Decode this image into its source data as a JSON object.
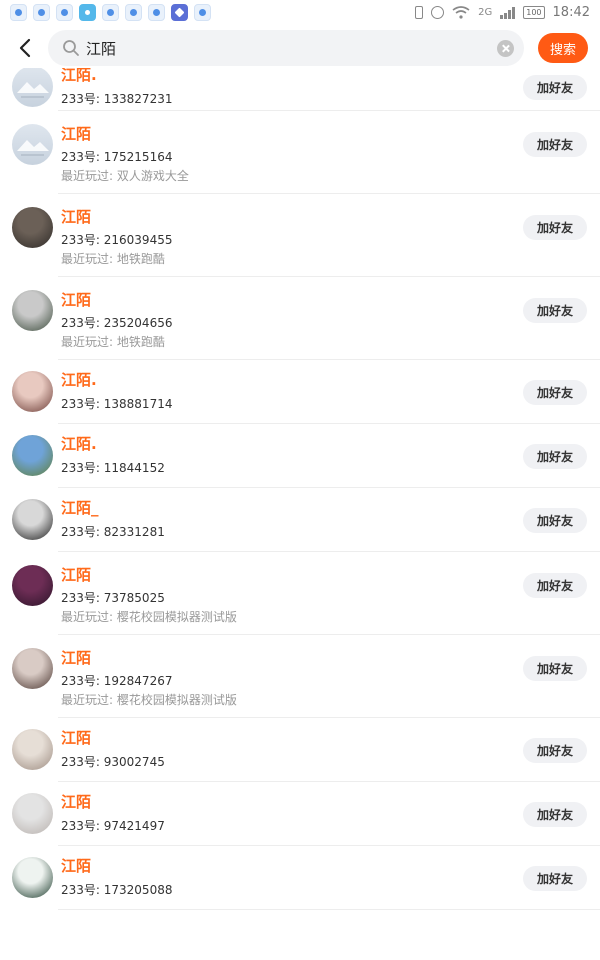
{
  "status_bar": {
    "notifications": [
      "paw-icon",
      "paw-icon",
      "paw-icon",
      "picture-icon",
      "paw-icon",
      "paw-icon",
      "paw-icon",
      "vpn-icon",
      "paw-icon"
    ],
    "network": "2G",
    "battery": "100",
    "time": "18:42"
  },
  "search": {
    "query": "江陌",
    "button_label": "搜索"
  },
  "colors": {
    "accent": "#ff5a14",
    "name": "#ff6a1a"
  },
  "results": [
    {
      "name": "江陌.",
      "uid": "233号: 133827231",
      "recent": "",
      "button": "加好友",
      "avatar": "placeholder"
    },
    {
      "name": "江陌",
      "uid": "233号: 175215164",
      "recent": "最近玩过: 双人游戏大全",
      "button": "加好友",
      "avatar": "placeholder"
    },
    {
      "name": "江陌",
      "uid": "233号: 216039455",
      "recent": "最近玩过: 地铁跑酷",
      "button": "加好友",
      "avatar": "photo"
    },
    {
      "name": "江陌",
      "uid": "233号: 235204656",
      "recent": "最近玩过: 地铁跑酷",
      "button": "加好友",
      "avatar": "photo"
    },
    {
      "name": "江陌.",
      "uid": "233号: 138881714",
      "recent": "",
      "button": "加好友",
      "avatar": "photo"
    },
    {
      "name": "江陌.",
      "uid": "233号: 11844152",
      "recent": "",
      "button": "加好友",
      "avatar": "photo"
    },
    {
      "name": "江陌_",
      "uid": "233号: 82331281",
      "recent": "",
      "button": "加好友",
      "avatar": "photo"
    },
    {
      "name": "江陌",
      "uid": "233号: 73785025",
      "recent": "最近玩过: 樱花校园模拟器测试版",
      "button": "加好友",
      "avatar": "photo"
    },
    {
      "name": "江陌",
      "uid": "233号: 192847267",
      "recent": "最近玩过: 樱花校园模拟器测试版",
      "button": "加好友",
      "avatar": "photo"
    },
    {
      "name": "江陌",
      "uid": "233号: 93002745",
      "recent": "",
      "button": "加好友",
      "avatar": "photo"
    },
    {
      "name": "江陌",
      "uid": "233号: 97421497",
      "recent": "",
      "button": "加好友",
      "avatar": "photo"
    },
    {
      "name": "江陌",
      "uid": "233号: 173205088",
      "recent": "",
      "button": "加好友",
      "avatar": "photo"
    }
  ]
}
